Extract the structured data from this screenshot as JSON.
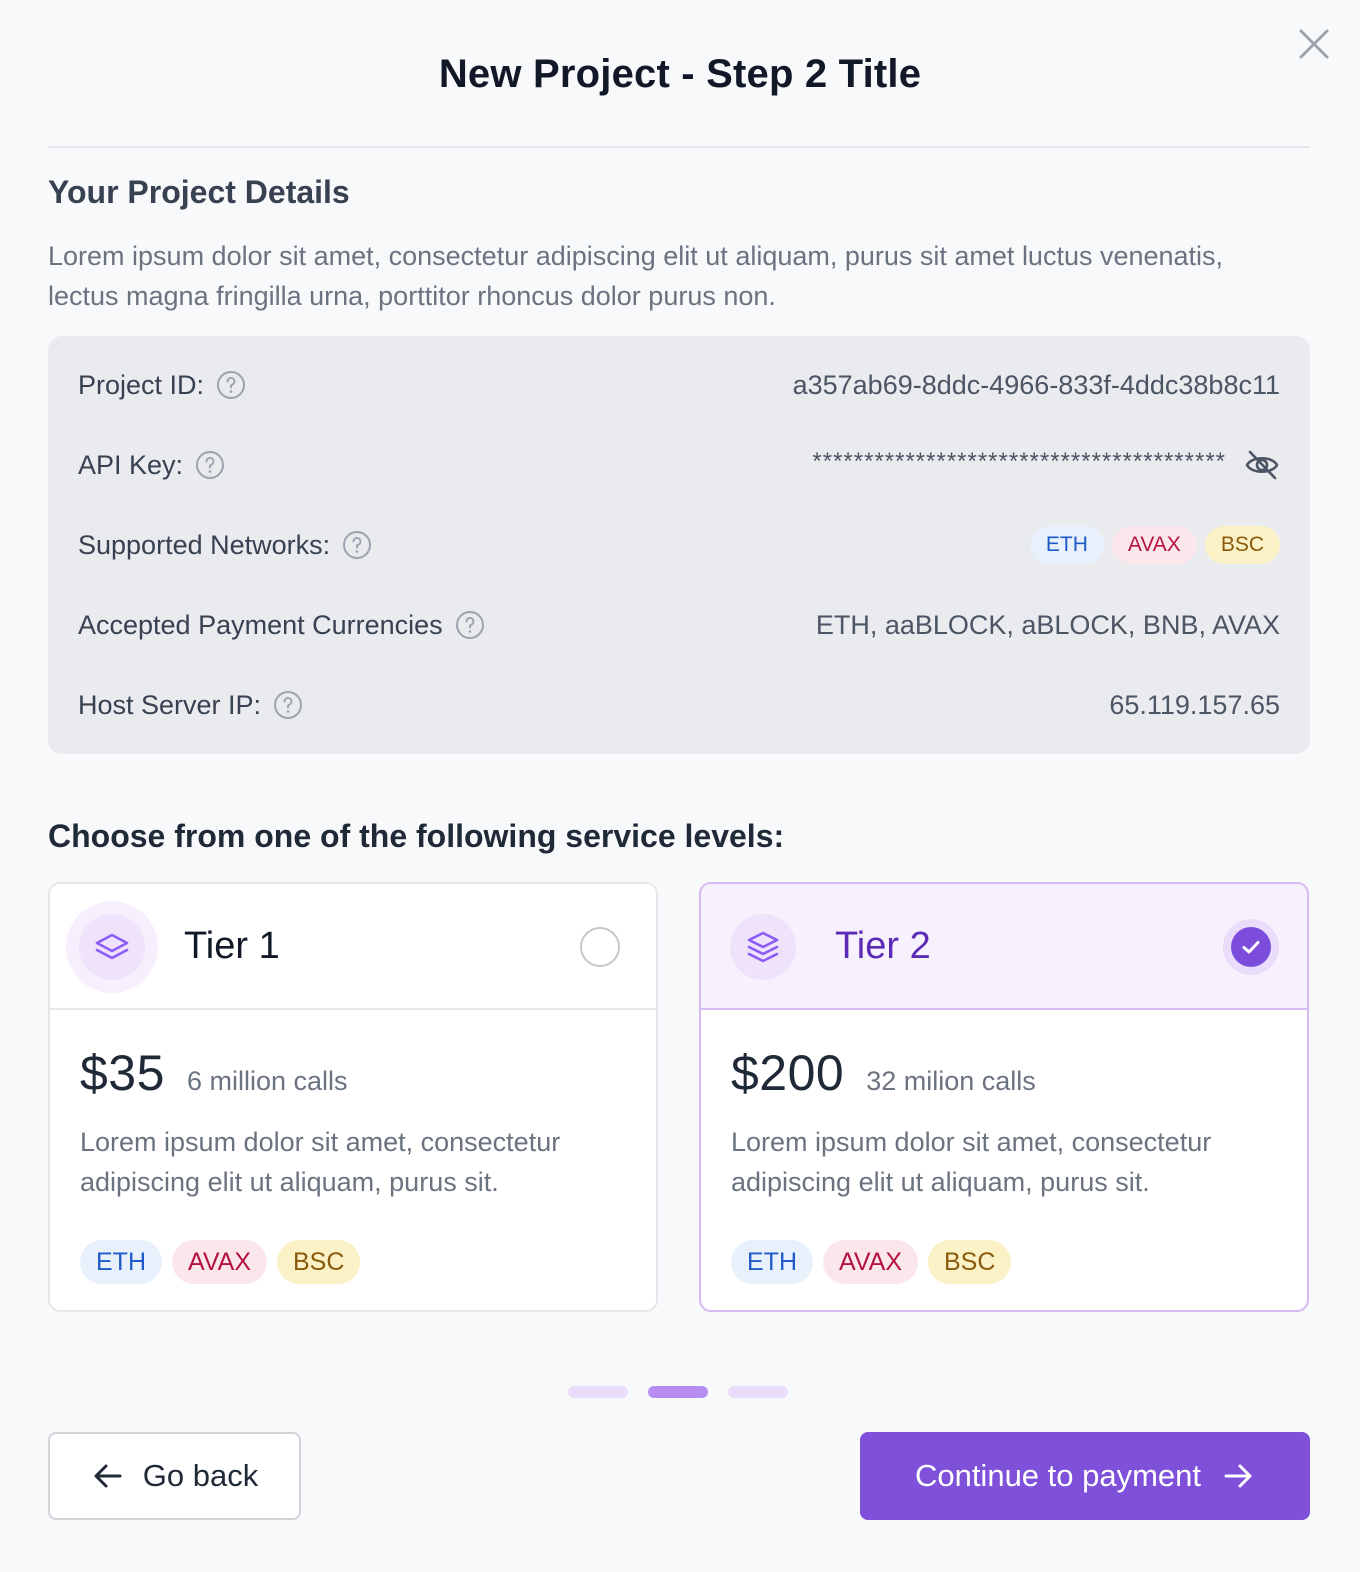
{
  "modal": {
    "title": "New Project - Step 2 Title",
    "close_icon": "close-icon"
  },
  "details": {
    "heading": "Your Project Details",
    "description": "Lorem ipsum dolor sit amet, consectetur adipiscing elit ut aliquam, purus sit amet luctus venenatis, lectus magna fringilla urna, porttitor rhoncus dolor purus non.",
    "rows": {
      "project_id": {
        "label": "Project ID:",
        "value": "a357ab69-8ddc-4966-833f-4ddc38b8c11"
      },
      "api_key": {
        "label": "API Key:",
        "value": "****************************************"
      },
      "networks": {
        "label": "Supported Networks:",
        "badges": [
          "ETH",
          "AVAX",
          "BSC"
        ]
      },
      "currencies": {
        "label": "Accepted Payment Currencies",
        "value": "ETH, aaBLOCK, aBLOCK, BNB, AVAX"
      },
      "host_ip": {
        "label": "Host Server IP:",
        "value": "65.119.157.65"
      }
    }
  },
  "service": {
    "heading": "Choose from one of the following service levels:",
    "tiers": [
      {
        "name": "Tier 1",
        "price": "$35",
        "calls": "6 million calls",
        "description": "Lorem ipsum dolor sit amet, consectetur adipiscing elit ut aliquam, purus sit.",
        "badges": [
          "ETH",
          "AVAX",
          "BSC"
        ],
        "selected": false
      },
      {
        "name": "Tier 2",
        "price": "$200",
        "calls": "32 milion calls",
        "description": "Lorem ipsum dolor sit amet, consectetur adipiscing elit ut aliquam, purus sit.",
        "badges": [
          "ETH",
          "AVAX",
          "BSC"
        ],
        "selected": true
      }
    ]
  },
  "pagination": {
    "total_steps": 3,
    "current_step": 2
  },
  "footer": {
    "back_label": "Go back",
    "continue_label": "Continue to payment"
  },
  "colors": {
    "accent": "#7f50da",
    "eth_text": "#1e5ac8",
    "avax_text": "#b3133e",
    "bsc_text": "#8a5a0a"
  }
}
